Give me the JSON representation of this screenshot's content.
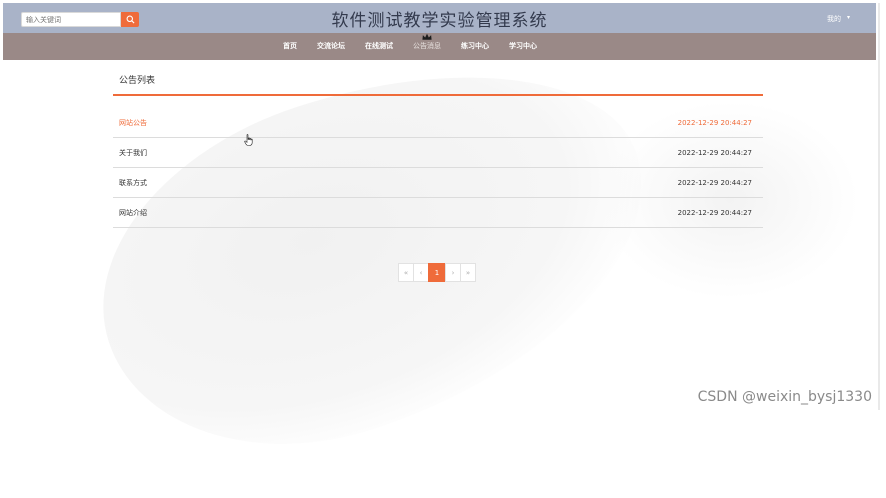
{
  "search": {
    "placeholder": "输入关键词",
    "button_icon": "search-icon"
  },
  "header": {
    "title": "软件测试教学实验管理系统",
    "user_label": "我的",
    "user_caret": "▾"
  },
  "nav": {
    "items": [
      {
        "label": "首页"
      },
      {
        "label": "交流论坛"
      },
      {
        "label": "在线测试"
      },
      {
        "label": "公告消息",
        "active": true
      },
      {
        "label": "练习中心"
      },
      {
        "label": "学习中心"
      }
    ]
  },
  "panel": {
    "title": "公告列表",
    "rows": [
      {
        "title": "网站公告",
        "time": "2022-12-29 20:44:27"
      },
      {
        "title": "关于我们",
        "time": "2022-12-29 20:44:27"
      },
      {
        "title": "联系方式",
        "time": "2022-12-29 20:44:27"
      },
      {
        "title": "网站介绍",
        "time": "2022-12-29 20:44:27"
      }
    ]
  },
  "pagination": {
    "first": "«",
    "prev": "‹",
    "current": "1",
    "next": "›",
    "last": "»"
  },
  "watermark": "CSDN @weixin_bysj1330",
  "colors": {
    "accent": "#ef6b3a",
    "header_bg": "#a9b3c8",
    "nav_bg": "#9a8987"
  }
}
